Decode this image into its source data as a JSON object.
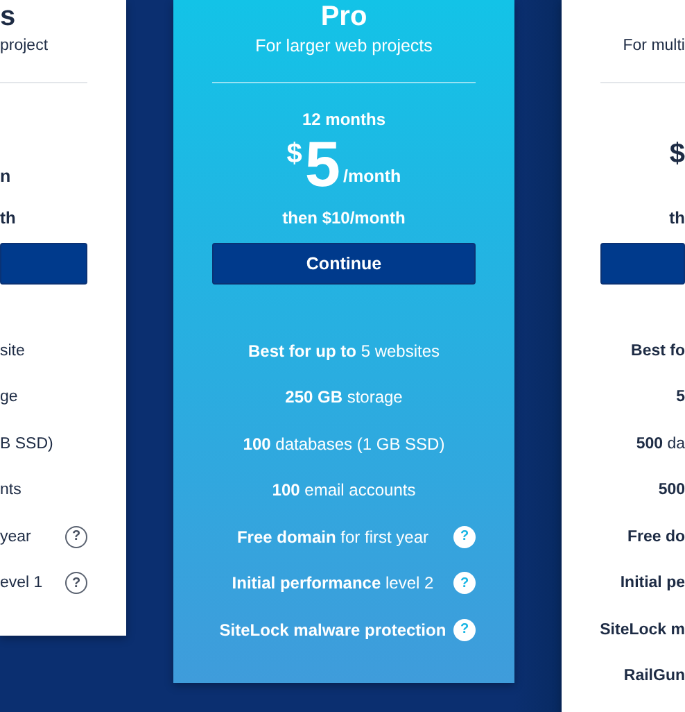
{
  "plans": [
    {
      "kind": "left-edge",
      "title": "s",
      "subtitle": "project",
      "price": {
        "unit": "n"
      },
      "renewal": "th",
      "show_button": true,
      "features": [
        {
          "text": "site"
        },
        {
          "text": "ge"
        },
        {
          "text": "B SSD)"
        },
        {
          "text": "nts"
        },
        {
          "text": "year",
          "help": "?"
        },
        {
          "text": "evel 1",
          "help": "?"
        }
      ]
    },
    {
      "kind": "featured",
      "title": "Pro",
      "subtitle": "For larger web projects",
      "term": "12 months",
      "price": {
        "currency": "$",
        "amount": "5",
        "unit": "/month"
      },
      "renewal": "then $10/month",
      "show_button": true,
      "button_label": "Continue",
      "features": [
        {
          "text": "**Best for up to** 5 websites"
        },
        {
          "text": "**250 GB** storage"
        },
        {
          "text": "**100** databases (1 GB SSD)"
        },
        {
          "text": "**100** email accounts"
        },
        {
          "text": "**Free domain** for first year",
          "help": "?"
        },
        {
          "text": "**Initial performance** level 2",
          "help": "?"
        },
        {
          "text": "**SiteLock malware protection**",
          "help": "?"
        }
      ]
    },
    {
      "kind": "right-edge",
      "subtitle": "For multi",
      "price": {
        "currency": "$"
      },
      "renewal": "th",
      "show_button": true,
      "features": [
        {
          "text": "**Best fo**"
        },
        {
          "text": "**5**"
        },
        {
          "text": "**500** da"
        },
        {
          "text": "**500**"
        },
        {
          "text": "**Free do**"
        },
        {
          "text": "**Initial pe**"
        },
        {
          "text": "**SiteLock m**"
        },
        {
          "text": "**RailGun**"
        }
      ]
    }
  ]
}
